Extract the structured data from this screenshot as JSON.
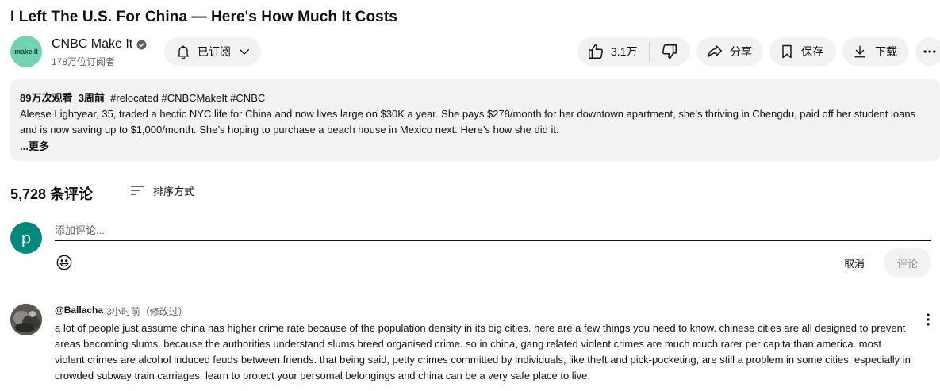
{
  "video": {
    "title": "I Left The U.S. For China — Here's How Much It Costs"
  },
  "channel": {
    "avatar_text": "make it",
    "name": "CNBC Make It",
    "subscribers": "178万位订阅者",
    "subscribe_label": "已订阅"
  },
  "actions": {
    "like_count": "3.1万",
    "share_label": "分享",
    "save_label": "保存",
    "download_label": "下载"
  },
  "description": {
    "views": "89万次观看",
    "age": "3周前",
    "tags": "#relocated #CNBCMakeIt #CNBC",
    "text": "Aleese Lightyear, 35, traded a hectic NYC life for China and now lives large on $30K a year. She pays $278/month for her downtown apartment, she’s thriving in Chengdu, paid off her student loans and is now saving up to $1,000/month. She’s hoping to purchase a beach house in Mexico next. Here’s how she did it.",
    "more_label": "...更多"
  },
  "comments": {
    "count_label": "5,728 条评论",
    "sort_label": "排序方式",
    "input_placeholder": "添加评论...",
    "user_initial": "p",
    "cancel_label": "取消",
    "submit_label": "评论",
    "items": [
      {
        "author": "@Ballacha",
        "time": "3小时前（修改过）",
        "text": "a lot of people just assume china has higher crime rate because of the population density in its big cities. here are a few things you need to know. chinese cities are all designed to prevent areas becoming slums. because the authorities understand slums breed organised crime. so in china, gang related violent crimes are much much rarer per capita than america. most violent crimes are alcohol induced feuds between friends. that being said, petty crimes committed by individuals, like theft and pick-pocketing, are still a problem in some cities, especially in crowded subway train carriages. learn to protect your persomal belongings and china can be a very safe place to live."
      }
    ]
  },
  "colors": {
    "pill_bg": "#f2f2f2",
    "channel_avatar": "#6fd3b4",
    "user_avatar": "#00897b",
    "secondary_text": "#606060"
  }
}
